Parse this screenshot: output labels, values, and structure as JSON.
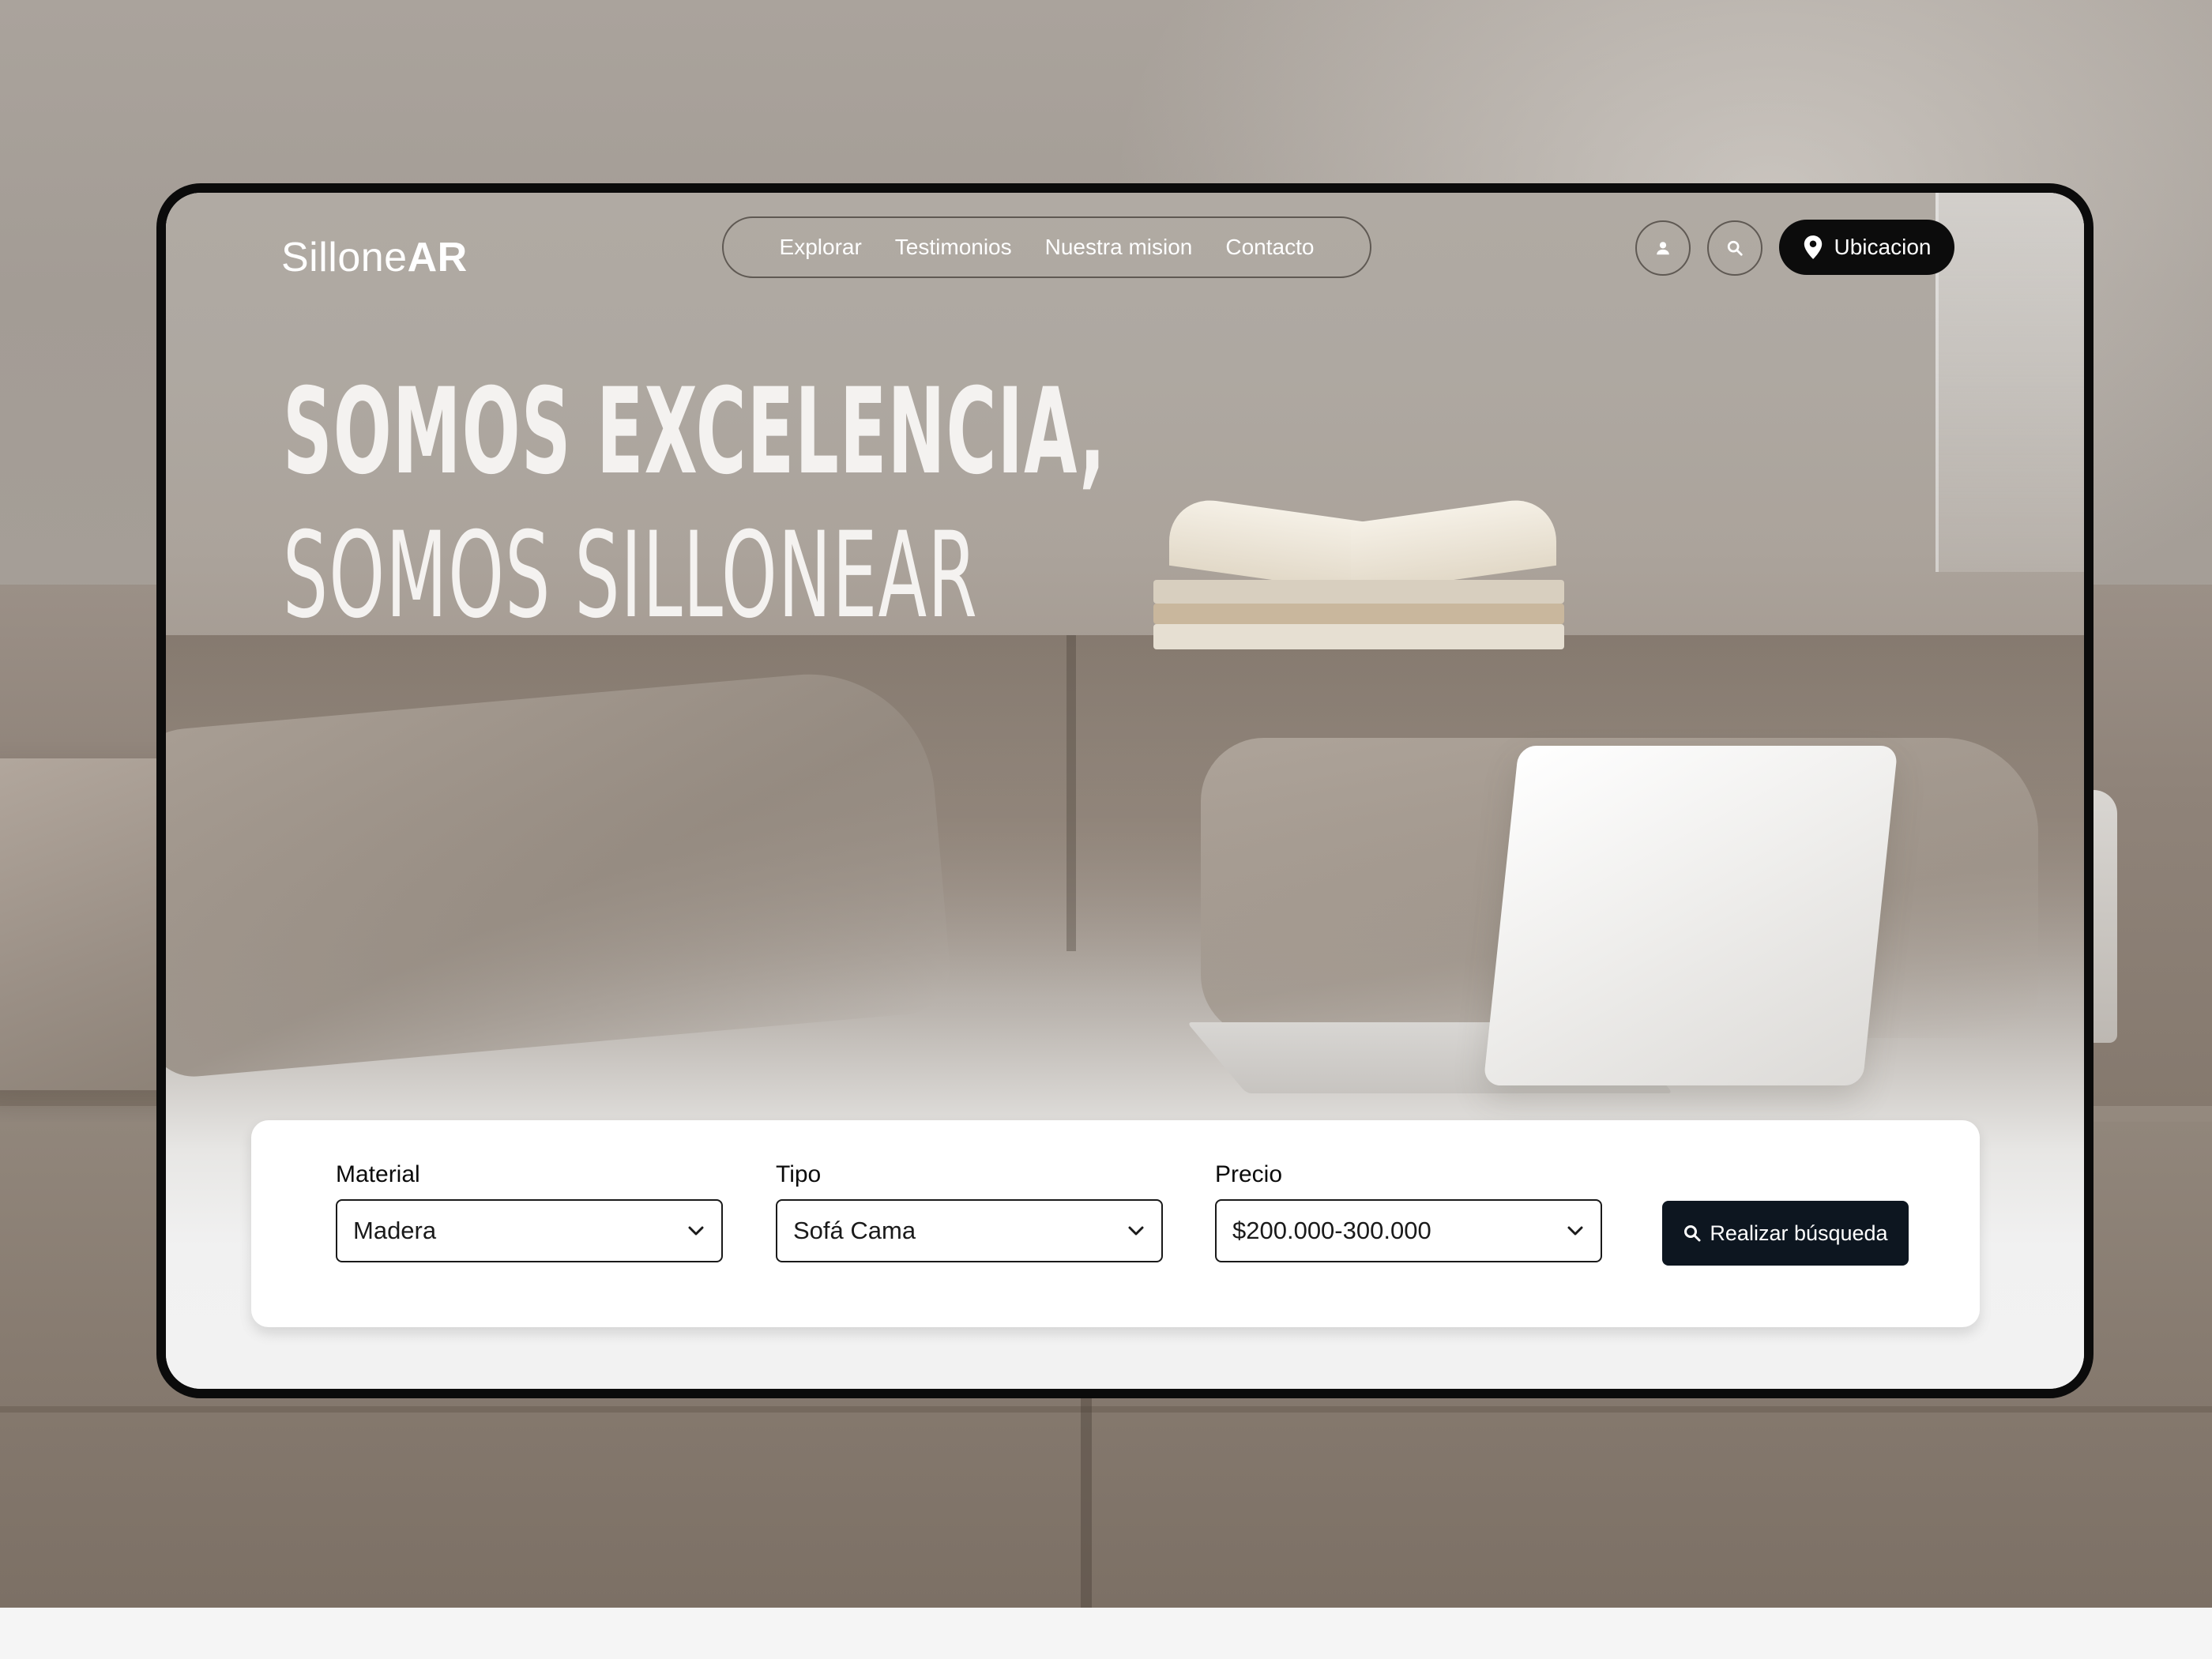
{
  "brand": {
    "logo_light": "Sillone",
    "logo_bold": "AR"
  },
  "nav": {
    "links": [
      "Explorar",
      "Testimonios",
      "Nuestra mision",
      "Contacto"
    ],
    "location_button": "Ubicacion"
  },
  "hero": {
    "line1": "SOMOS EXCELENCIA,",
    "line2": "SOMOS SILLONEAR"
  },
  "search": {
    "fields": [
      {
        "label": "Material",
        "value": "Madera"
      },
      {
        "label": "Tipo",
        "value": "Sofá Cama"
      },
      {
        "label": "Precio",
        "value": "$200.000-300.000"
      }
    ],
    "button_label": "Realizar búsqueda"
  },
  "icons": {
    "profile": "user-icon",
    "search": "search-icon",
    "location": "location-pin-icon",
    "dropdown": "chevron-down-icon"
  },
  "colors": {
    "button_dark": "#0d1620",
    "location_button": "#0c0c0c",
    "frame_border": "#0b0b0b"
  }
}
